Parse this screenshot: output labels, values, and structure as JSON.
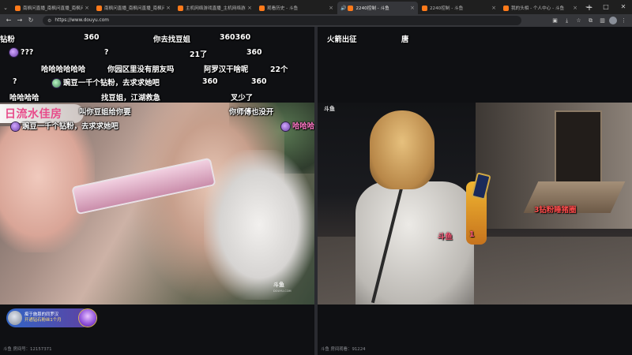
{
  "browser": {
    "tabs": [
      {
        "title": "南枫问直播_南枫问直播_南枫问直播",
        "active": false
      },
      {
        "title": "南枫问直播_南枫问直播_南枫问直播",
        "active": false
      },
      {
        "title": "主机网络游戏直播_主机网络游戏直播",
        "active": false
      },
      {
        "title": "观看历史 - 斗鱼",
        "active": false
      },
      {
        "title": "2240控制 - 斗鱼",
        "active": true,
        "audio": true
      },
      {
        "title": "2240控制 - 斗鱼",
        "active": false
      },
      {
        "title": "我的头相 - 个人中心 - 斗鱼",
        "active": false
      }
    ],
    "new_tab_label": "+",
    "address": "https://www.douyu.com",
    "window_controls": {
      "minimize": "—",
      "maximize": "□",
      "close": "✕"
    }
  },
  "left_player": {
    "ribbon_text": "日流水佳房",
    "watermark_title": "斗鱼",
    "watermark_sub": "DOUYU.COM",
    "room_info": "斗鱼 房间号：12157371",
    "gift_banner": {
      "line1": "痴于施恩的同罗汉",
      "line2": "开通钻石粉丝1个月"
    },
    "danmaku": [
      {
        "text": "钻粉",
        "style": "white"
      },
      {
        "text": "360",
        "style": "white"
      },
      {
        "text": "你去找豆姐",
        "style": "white"
      },
      {
        "text": "360360",
        "style": "white"
      },
      {
        "text": "???",
        "style": "white",
        "badge": true
      },
      {
        "text": "?",
        "style": "white"
      },
      {
        "text": "21了",
        "style": "white"
      },
      {
        "text": "360",
        "style": "white"
      },
      {
        "text": "哈哈哈哈哈哈",
        "style": "white"
      },
      {
        "text": "你园区里没有朋友吗",
        "style": "white"
      },
      {
        "text": "阿罗汉干啥呢",
        "style": "white"
      },
      {
        "text": "22个",
        "style": "white"
      },
      {
        "text": "?",
        "style": "white"
      },
      {
        "text": "豌豆一千个钻粉，去求求她吧",
        "style": "white",
        "badge": "green"
      },
      {
        "text": "360",
        "style": "white"
      },
      {
        "text": "360",
        "style": "white"
      },
      {
        "text": "哈哈哈哈",
        "style": "white"
      },
      {
        "text": "找豆姐，江湖救急",
        "style": "white"
      },
      {
        "text": "叉少了",
        "style": "white"
      },
      {
        "text": "叫你豆姐给你要",
        "style": "white"
      },
      {
        "text": "你师傅也没开",
        "style": "white"
      },
      {
        "text": "豌豆一千个钻粉，去求求她吧",
        "style": "white",
        "badge": true
      },
      {
        "text": "哈哈哈",
        "style": "pink",
        "badge": true
      }
    ]
  },
  "right_player": {
    "watermark_title": "斗鱼",
    "room_info": "斗鱼 房间观看：91224",
    "danmaku": [
      {
        "text": "火箭出征",
        "style": "white"
      },
      {
        "text": "唐",
        "style": "white"
      },
      {
        "text": "3钻粉睡猪圈",
        "style": "red"
      },
      {
        "text": "斗鱼",
        "style": "pink"
      },
      {
        "text": "1",
        "style": "pink"
      }
    ]
  },
  "colors": {
    "accent_pink": "#e84b8a",
    "danmaku_red": "#ff4c4c",
    "browser_chrome": "#35363a",
    "tab_strip": "#1f1f1f"
  }
}
